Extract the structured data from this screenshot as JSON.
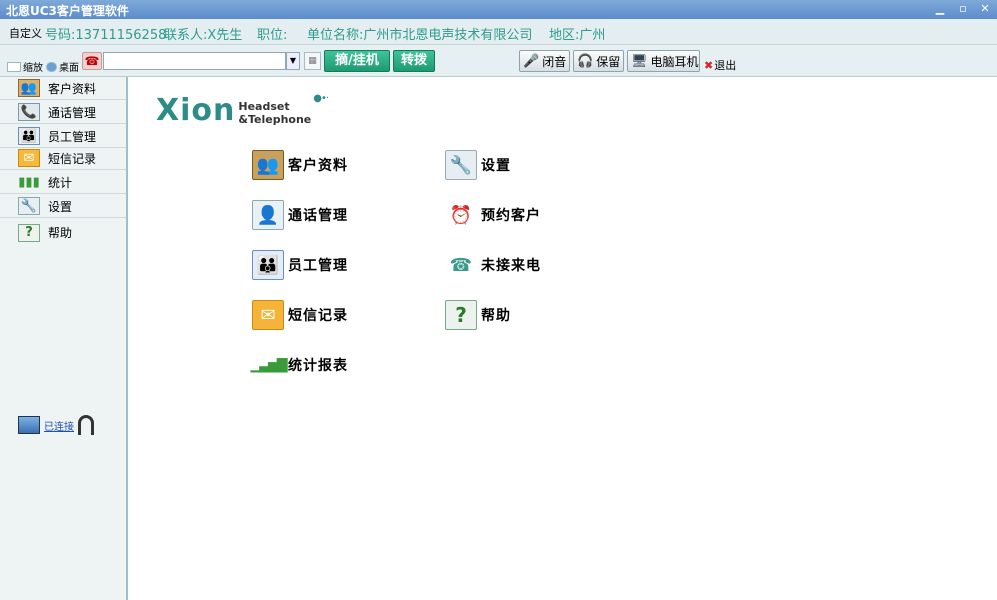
{
  "window": {
    "title": "北恩UC3客户管理软件",
    "minimize": "▁",
    "restore": "▫",
    "close": "✕"
  },
  "info": {
    "custom": "自定义",
    "phone": "号码:13711156258",
    "contact": "联系人:X先生",
    "position": "职位:",
    "company": "单位名称:广州市北恩电声技术有限公司",
    "region": "地区:广州"
  },
  "toolbar": {
    "shrink": "缩放",
    "desktop": "桌面",
    "dial_value": "",
    "pickup_hangup": "摘/挂机",
    "transfer": "转拨",
    "mute": "闭音",
    "hold": "保留",
    "pc_headset": "电脑耳机",
    "exit": "退出"
  },
  "sidebar": {
    "items": [
      {
        "label": "客户资料",
        "icon": "contacts-icon"
      },
      {
        "label": "通话管理",
        "icon": "call-management-icon"
      },
      {
        "label": "员工管理",
        "icon": "staff-icon"
      },
      {
        "label": "短信记录",
        "icon": "envelope-icon"
      },
      {
        "label": "统计",
        "icon": "bar-chart-icon"
      },
      {
        "label": "设置",
        "icon": "settings-icon"
      },
      {
        "label": "帮助",
        "icon": "help-icon"
      }
    ],
    "connection_status": "已连接"
  },
  "logo": {
    "brand": "Xion",
    "line1": "Headset",
    "line2": "&Telephone"
  },
  "tiles": [
    {
      "label": "客户资料",
      "icon": "contacts-icon"
    },
    {
      "label": "设置",
      "icon": "settings-icon"
    },
    {
      "label": "通话管理",
      "icon": "call-management-icon"
    },
    {
      "label": "预约客户",
      "icon": "alarm-clock-icon"
    },
    {
      "label": "员工管理",
      "icon": "staff-icon"
    },
    {
      "label": "未接来电",
      "icon": "missed-call-icon"
    },
    {
      "label": "短信记录",
      "icon": "envelope-icon"
    },
    {
      "label": "帮助",
      "icon": "help-icon"
    },
    {
      "label": "统计报表",
      "icon": "bar-chart-icon"
    }
  ],
  "colors": {
    "title_bar": "#5b8ccb",
    "info_text": "#2f9b8d",
    "action_button": "#1f9a70",
    "sidebar_border": "#9bc0c6"
  }
}
